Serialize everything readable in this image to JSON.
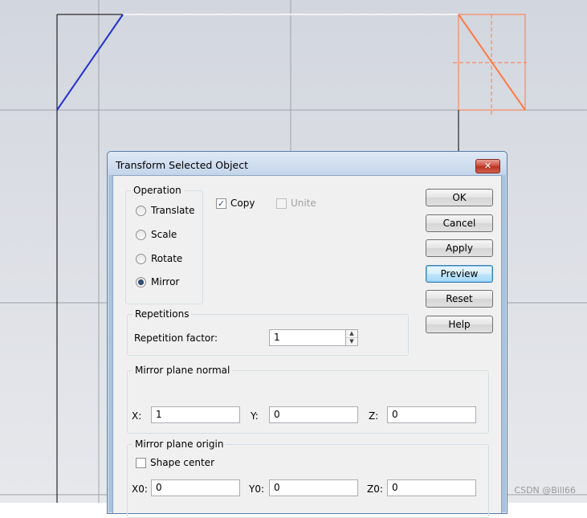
{
  "dialog": {
    "title": "Transform Selected Object",
    "close_symbol": "✕"
  },
  "operation": {
    "label": "Operation",
    "options": [
      "Translate",
      "Scale",
      "Rotate",
      "Mirror"
    ],
    "selected": "Mirror"
  },
  "copy": {
    "label": "Copy",
    "checked": true,
    "check_symbol": "✓"
  },
  "unite": {
    "label": "Unite",
    "checked": false,
    "enabled": false
  },
  "buttons": {
    "ok": "OK",
    "cancel": "Cancel",
    "apply": "Apply",
    "preview": "Preview",
    "reset": "Reset",
    "help": "Help"
  },
  "repetitions": {
    "label": "Repetitions",
    "factor_label": "Repetition factor:",
    "factor_value": "1",
    "spin_up": "▲",
    "spin_down": "▼"
  },
  "mirror_normal": {
    "label": "Mirror plane normal",
    "x_label": "X:",
    "x_value": "1",
    "y_label": "Y:",
    "y_value": "0",
    "z_label": "Z:",
    "z_value": "0"
  },
  "mirror_origin": {
    "label": "Mirror plane origin",
    "shape_center_label": "Shape center",
    "shape_center_checked": false,
    "x0_label": "X0:",
    "x0_value": "0",
    "y0_label": "Y0:",
    "y0_value": "0",
    "z0_label": "Z0:",
    "z0_value": "0"
  },
  "watermark": "CSDN @Bill66",
  "colors": {
    "original_edge": "#1f2fd6",
    "mirrored_shape": "#ff7a45",
    "dialog_accent": "#3c7fb1"
  }
}
